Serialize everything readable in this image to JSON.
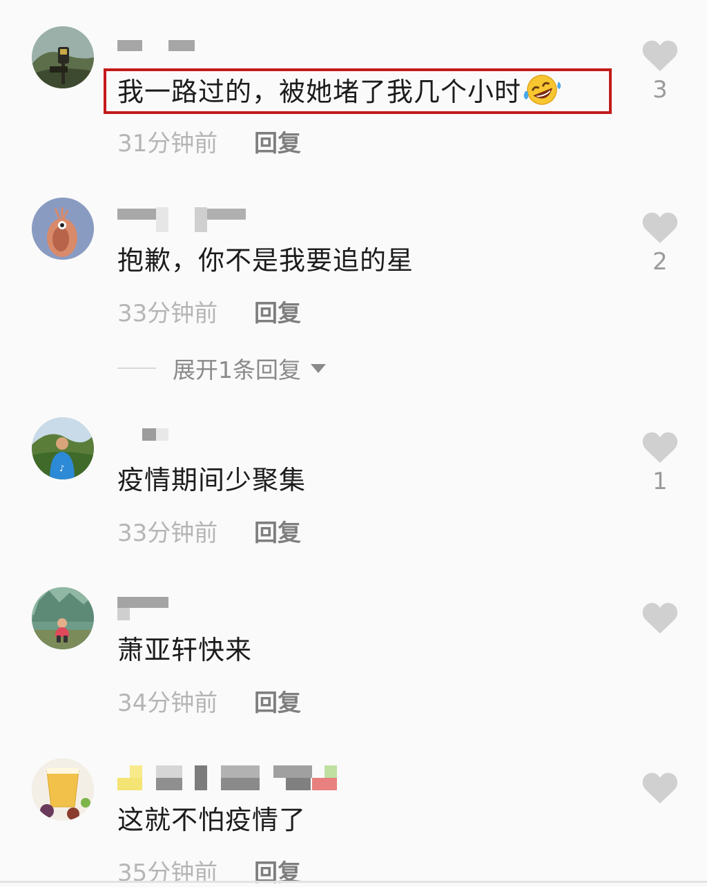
{
  "comments": [
    {
      "username": "",
      "text": "我一路过的，被她堵了我几个小时",
      "emoji": "rolling-on-floor-laughing-emoji",
      "time": "31分钟前",
      "reply": "回复",
      "likes": "3",
      "highlighted": true,
      "highlight_color": "#c41a1a"
    },
    {
      "username": "",
      "text": "抱歉，你不是我要追的星",
      "time": "33分钟前",
      "reply": "回复",
      "likes": "2",
      "expand_label": "展开1条回复"
    },
    {
      "username": "",
      "text": "疫情期间少聚集",
      "time": "33分钟前",
      "reply": "回复",
      "likes": "1"
    },
    {
      "username": "",
      "text": "萧亚轩快来",
      "time": "34分钟前",
      "reply": "回复",
      "likes": ""
    },
    {
      "username": "",
      "text": "这就不怕疫情了",
      "time": "35分钟前",
      "reply": "回复",
      "likes": ""
    }
  ],
  "colors": {
    "text": "#1c1c1c",
    "time": "#b5b5b5",
    "reply": "#7e7e7e",
    "heart": "#d0d0d0",
    "background": "#fafafa"
  },
  "icons": {
    "like": "heart-icon",
    "expand": "triangle-down-icon"
  }
}
